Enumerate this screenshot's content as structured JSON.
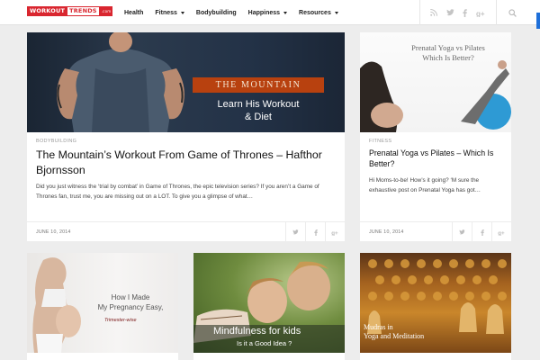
{
  "site": {
    "logo_left": "WORKOUT",
    "logo_right": "TRENDS",
    "logo_suffix": ".com"
  },
  "nav": [
    {
      "label": "Health",
      "has_dropdown": false
    },
    {
      "label": "Fitness",
      "has_dropdown": true
    },
    {
      "label": "Bodybuilding",
      "has_dropdown": false
    },
    {
      "label": "Happiness",
      "has_dropdown": true
    },
    {
      "label": "Resources",
      "has_dropdown": true
    }
  ],
  "social_icons": [
    "rss-icon",
    "twitter-icon",
    "facebook-icon",
    "google-plus-icon"
  ],
  "colors": {
    "brand_red": "#d9262f",
    "accent_blue": "#1e6fd9",
    "mountain_orange": "#b8410f"
  },
  "featured": {
    "image_band": "THE MOUNTAIN",
    "image_line1": "Learn His Workout",
    "image_line2": "& Diet",
    "category": "BODYBUILDING",
    "title": "The Mountain’s Workout From Game of Thrones – Hafthor Bjornsson",
    "excerpt": "Did you just witness the ‘trial by combat’ in Game of Thrones, the epic television series? If you aren’t a Game of Thrones fan, trust me, you are missing out on a LOT. To give you a glimpse of what…",
    "date": "JUNE 10, 2014"
  },
  "side_card": {
    "image_line1": "Prenatal Yoga vs Pilates",
    "image_line2": "Which Is Better?",
    "category": "FITNESS",
    "title": "Prenatal Yoga vs Pilates – Which Is Better?",
    "excerpt": "Hi Moms-to-be! How’s it going? ‘M sure the exhaustive post on Prenatal Yoga has got…",
    "date": "JUNE 10, 2014"
  },
  "row2": [
    {
      "line1": "How I Made",
      "line2": "My Pregnancy Easy,",
      "line3": "Trimester-wise"
    },
    {
      "line1": "Mindfulness for kids",
      "line2": "Is it a Good Idea ?"
    },
    {
      "line1": "Mudras in",
      "line2": "Yoga and Meditation"
    }
  ]
}
